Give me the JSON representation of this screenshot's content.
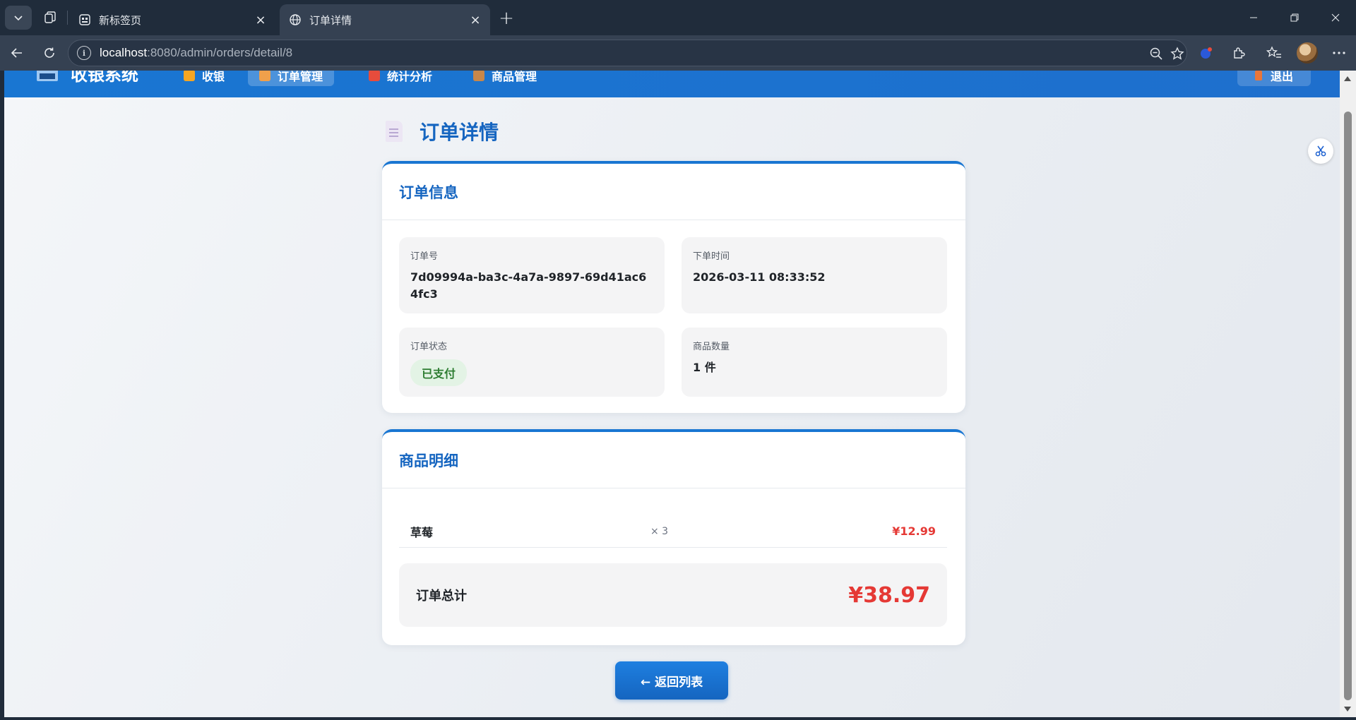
{
  "browser": {
    "tabs": [
      {
        "title": "新标签页",
        "icon": "new-tab-page-icon",
        "active": false
      },
      {
        "title": "订单详情",
        "icon": "globe-icon",
        "active": true
      }
    ],
    "url_host": "localhost",
    "url_rest": ":8080/admin/orders/detail/8"
  },
  "app": {
    "logo": "收银系统",
    "nav": [
      {
        "label": "收银",
        "icon_color": "#f5a623",
        "active": false
      },
      {
        "label": "订单管理",
        "icon_color": "#f0a04b",
        "active": true
      },
      {
        "label": "统计分析",
        "icon_color": "#e74c3c",
        "active": false
      },
      {
        "label": "商品管理",
        "icon_color": "#c8874a",
        "active": false
      }
    ],
    "logout": "退出",
    "accent": "#1976d2"
  },
  "page": {
    "title": "订单详情"
  },
  "order_info": {
    "heading": "订单信息",
    "fields": {
      "order_no": {
        "label": "订单号",
        "value": "7d09994a-ba3c-4a7a-9897-69d41ac64fc3"
      },
      "order_time": {
        "label": "下单时间",
        "value": "2026-03-11 08:33:52"
      },
      "status": {
        "label": "订单状态",
        "value": "已支付"
      },
      "quantity": {
        "label": "商品数量",
        "value": "1 件"
      }
    }
  },
  "items": {
    "heading": "商品明细",
    "rows": [
      {
        "name": "草莓",
        "qty": "× 3",
        "price": "¥12.99"
      }
    ],
    "total_label": "订单总计",
    "total_value": "¥38.97"
  },
  "back_button": "← 返回列表"
}
